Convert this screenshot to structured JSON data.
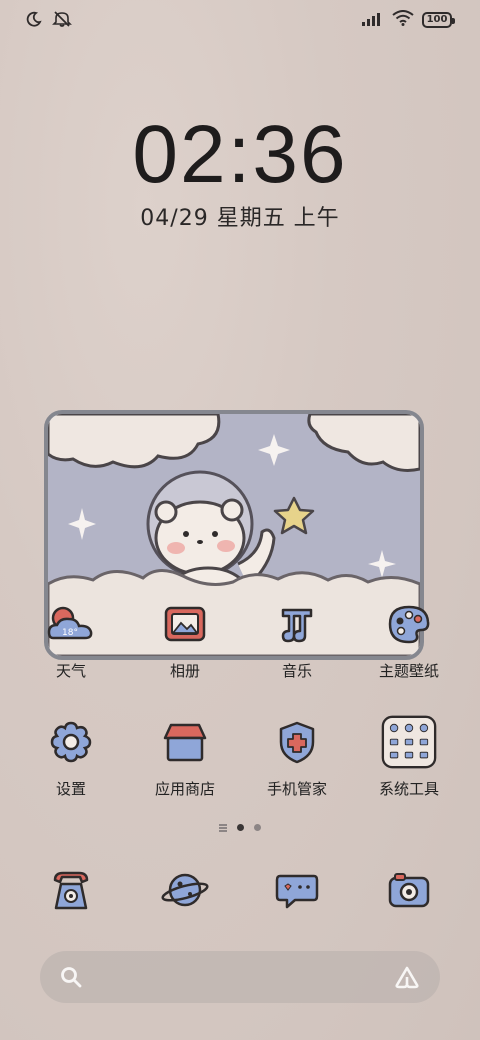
{
  "status_bar": {
    "battery": "100",
    "icons": [
      "moon-icon",
      "mute-icon",
      "signal-icon",
      "wifi-icon",
      "battery-icon"
    ]
  },
  "lockscreen": {
    "time": "02:36",
    "date": "04/29 星期五 上午"
  },
  "apps_row1": [
    {
      "label": "天气",
      "icon": "weather-icon",
      "temp": "18°"
    },
    {
      "label": "相册",
      "icon": "gallery-icon"
    },
    {
      "label": "音乐",
      "icon": "music-icon"
    },
    {
      "label": "主题壁纸",
      "icon": "palette-icon"
    }
  ],
  "apps_row2": [
    {
      "label": "设置",
      "icon": "gear-icon"
    },
    {
      "label": "应用商店",
      "icon": "store-icon"
    },
    {
      "label": "手机管家",
      "icon": "shield-icon"
    },
    {
      "label": "系统工具",
      "icon": "folder-icon"
    }
  ],
  "page_indicator": {
    "pages": 3,
    "current": 2
  },
  "dock": [
    {
      "icon": "phone-icon"
    },
    {
      "icon": "planet-icon"
    },
    {
      "icon": "message-icon"
    },
    {
      "icon": "camera-icon"
    }
  ],
  "search_bar": {
    "icons": [
      "search-icon",
      "assistant-icon"
    ]
  },
  "colors": {
    "accent_blue": "#7b8fc8",
    "accent_red": "#d9685e",
    "outline": "#2f2b2b"
  }
}
